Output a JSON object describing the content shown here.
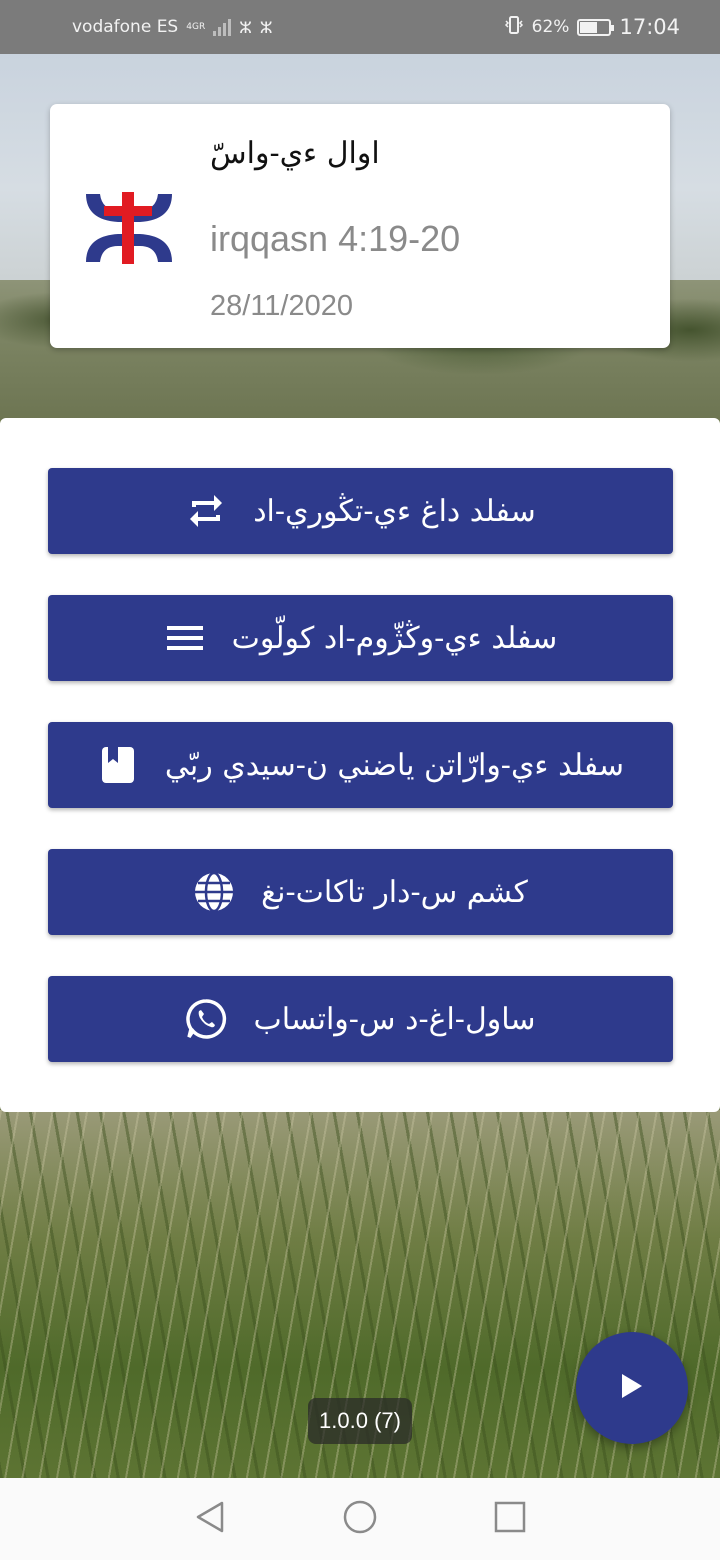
{
  "status_bar": {
    "carrier": "vodafone ES",
    "network": "4G",
    "network_sub": "R",
    "battery_percent": "62%",
    "battery_level": 0.62,
    "time": "17:04"
  },
  "verse_card": {
    "title": "اوال ءي-واسّ",
    "reference": "irqqasn 4:19-20",
    "date": "28/11/2020",
    "logo_icon": "amazigh-cross-logo-icon",
    "logo_colors": {
      "blue": "#2e3a8c",
      "red": "#e11b22"
    }
  },
  "menu": {
    "items": [
      {
        "label": "سفلد داغ ءي-تڭوري-اد",
        "icon": "repeat-icon"
      },
      {
        "label": "سفلد ءي-وڭژّوم-اد كولّوت",
        "icon": "menu-lines-icon"
      },
      {
        "label": "سفلد ءي-وارّاتن ياضني ن-سيدي ربّي",
        "icon": "bookmark-book-icon"
      },
      {
        "label": "كشم س-دار تاكات-نغ",
        "icon": "globe-icon"
      },
      {
        "label": "ساول-اغ-د س-واتساب",
        "icon": "whatsapp-icon"
      }
    ]
  },
  "fab": {
    "icon": "play-icon"
  },
  "version": {
    "label": "1.0.0 (7)"
  },
  "nav_bar": {
    "back_icon": "back-triangle-icon",
    "home_icon": "home-circle-icon",
    "recents_icon": "recents-square-icon"
  },
  "colors": {
    "primary": "#2e3a8c",
    "status_bar": "#7b7b7b",
    "card_text_secondary": "#8a8a8a"
  }
}
